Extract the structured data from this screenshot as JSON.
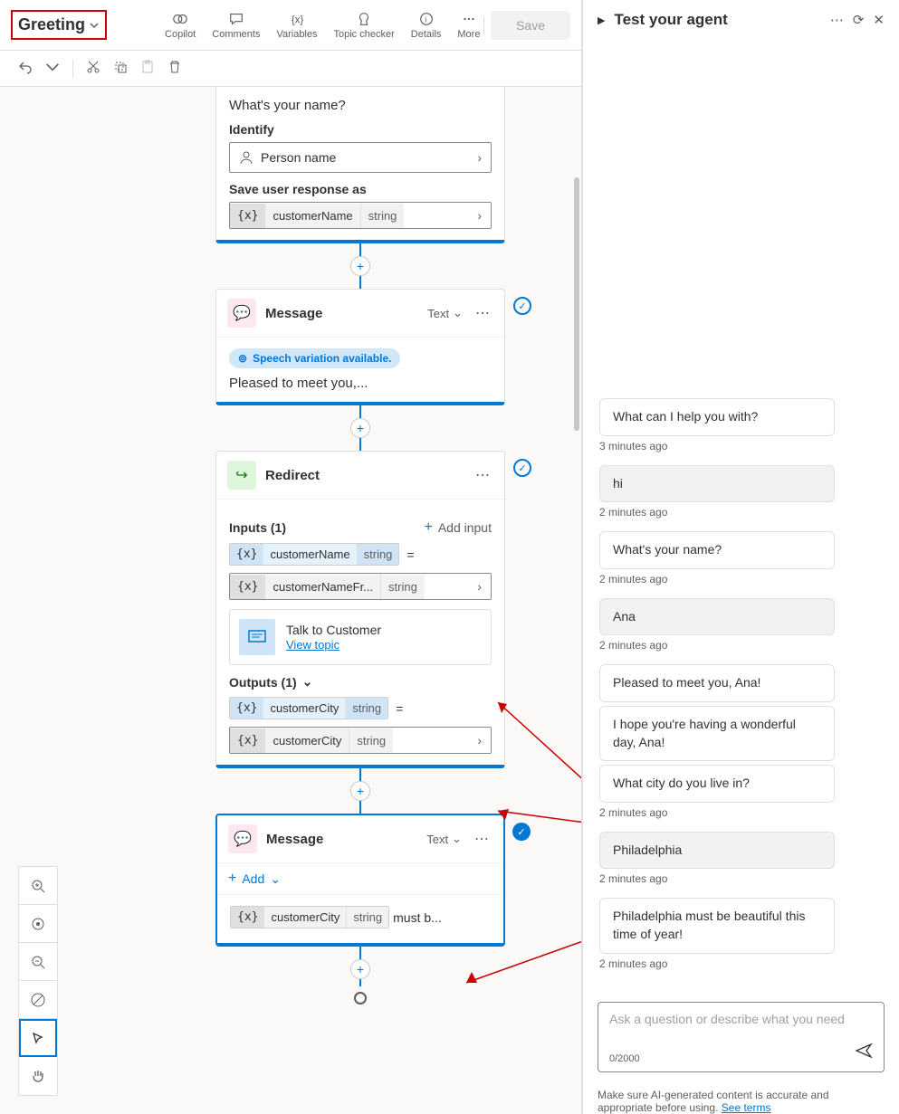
{
  "header": {
    "topic_name": "Greeting",
    "buttons": {
      "copilot": "Copilot",
      "comments": "Comments",
      "variables": "Variables",
      "topic_checker": "Topic checker",
      "details": "Details",
      "more": "More"
    },
    "save": "Save"
  },
  "question_node": {
    "prompt": "What's your name?",
    "identify_label": "Identify",
    "identify_value": "Person name",
    "save_as_label": "Save user response as",
    "var_name": "customerName",
    "var_type": "string"
  },
  "message_node1": {
    "title": "Message",
    "type_label": "Text",
    "speech_badge": "Speech variation available.",
    "text": "Pleased to meet you,..."
  },
  "redirect_node": {
    "title": "Redirect",
    "inputs_label": "Inputs (1)",
    "add_input": "Add input",
    "input_var": "customerName",
    "input_type": "string",
    "mapped_var": "customerNameFr...",
    "mapped_type": "string",
    "linked_topic": "Talk to Customer",
    "view_topic": "View topic",
    "outputs_label": "Outputs (1)",
    "output_var": "customerCity",
    "output_type": "string",
    "output_mapped_var": "customerCity",
    "output_mapped_type": "string"
  },
  "message_node2": {
    "title": "Message",
    "type_label": "Text",
    "add_label": "Add",
    "var_name": "customerCity",
    "var_type": "string",
    "suffix": "must b..."
  },
  "test_panel": {
    "title": "Test your agent",
    "messages": [
      {
        "who": "bot",
        "text": "What can I help you with?",
        "ts": "3 minutes ago"
      },
      {
        "who": "usr",
        "text": "hi",
        "ts": "2 minutes ago"
      },
      {
        "who": "bot",
        "text": "What's your name?",
        "ts": "2 minutes ago"
      },
      {
        "who": "usr",
        "text": "Ana",
        "ts": "2 minutes ago"
      },
      {
        "who": "bot",
        "text": "Pleased to meet you, Ana!",
        "ts": null
      },
      {
        "who": "bot",
        "text": "I hope you're having a wonderful day, Ana!",
        "ts": null
      },
      {
        "who": "bot",
        "text": "What city do you live in?",
        "ts": "2 minutes ago"
      },
      {
        "who": "usr",
        "text": "Philadelphia",
        "ts": "2 minutes ago"
      },
      {
        "who": "bot",
        "text": "Philadelphia must be beautiful this time of year!",
        "ts": "2 minutes ago"
      }
    ],
    "input_placeholder": "Ask a question or describe what you need",
    "char_count": "0/2000",
    "disclaimer": "Make sure AI-generated content is accurate and appropriate before using.",
    "see_terms": "See terms"
  }
}
